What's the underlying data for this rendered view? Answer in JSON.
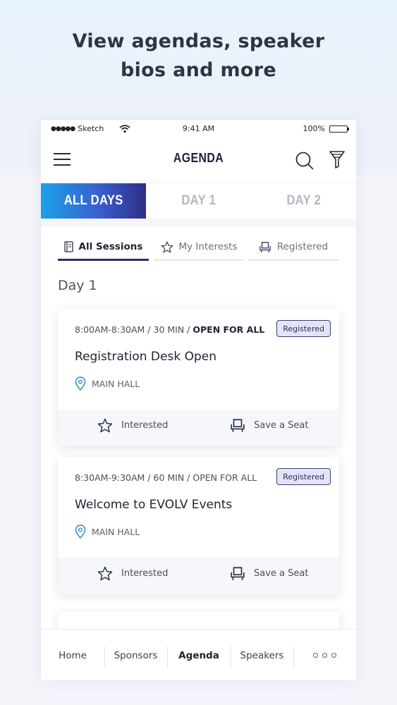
{
  "headline": {
    "line1": "View agendas, speaker",
    "line2": "bios and more"
  },
  "statusbar": {
    "carrier": "Sketch",
    "time": "9:41 AM",
    "battery": "100%"
  },
  "navbar": {
    "title": "AGENDA"
  },
  "tabs": [
    {
      "label": "ALL DAYS",
      "active": true
    },
    {
      "label": "DAY 1",
      "active": false
    },
    {
      "label": "DAY 2",
      "active": false
    }
  ],
  "subtabs": [
    {
      "label": "All Sessions",
      "active": true
    },
    {
      "label": "My Interests",
      "active": false
    },
    {
      "label": "Registered",
      "active": false
    }
  ],
  "day_heading": "Day 1",
  "sessions": [
    {
      "time": "8:00AM-8:30AM",
      "duration": "30 MIN",
      "access": "OPEN FOR ALL",
      "badge": "Registered",
      "title": "Registration Desk Open",
      "location": "MAIN HALL",
      "interested_label": "Interested",
      "seat_label": "Save a Seat"
    },
    {
      "time": "8:30AM-9:30AM",
      "duration": "60 MIN",
      "access": "OPEN FOR ALL",
      "badge": "Registered",
      "title": "Welcome to EVOLV Events",
      "location": "MAIN HALL",
      "interested_label": "Interested",
      "seat_label": "Save a Seat"
    }
  ],
  "bottom_nav": [
    {
      "label": "Home"
    },
    {
      "label": "Sponsors"
    },
    {
      "label": "Agenda",
      "active": true
    },
    {
      "label": "Speakers"
    }
  ],
  "colors": {
    "accent_start": "#1aa2e6",
    "accent_end": "#2e2f86",
    "badge_bg": "#e3e4f7"
  }
}
